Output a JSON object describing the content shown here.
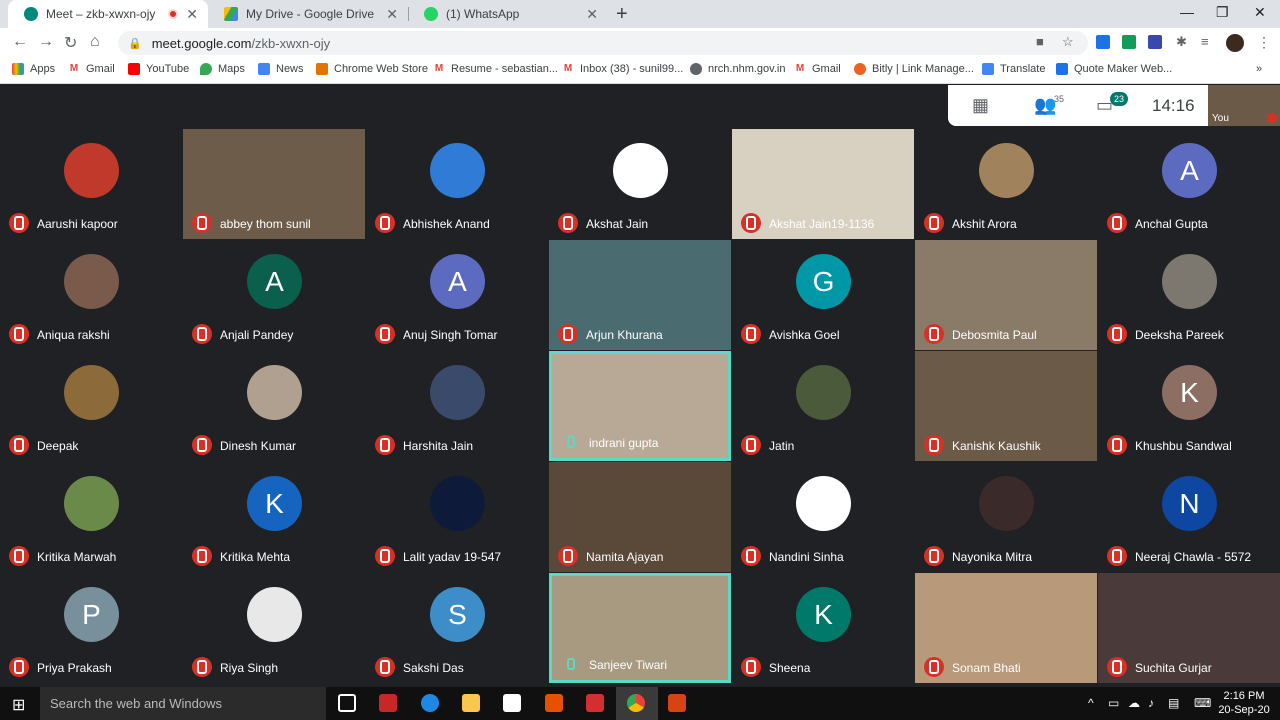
{
  "browser": {
    "tabs": [
      {
        "title": "Meet – zkb-xwxn-ojy",
        "icon": "meet-icon",
        "active": true
      },
      {
        "title": "My Drive - Google Drive",
        "icon": "drive-icon",
        "active": false
      },
      {
        "title": "(1) WhatsApp",
        "icon": "whatsapp-icon",
        "active": false
      }
    ],
    "url_host": "meet.google.com",
    "url_path": "/zkb-xwxn-ojy",
    "bookmarks": [
      "Apps",
      "Gmail",
      "YouTube",
      "Maps",
      "News",
      "Chrome Web Store",
      "Resume - sebastian...",
      "Inbox (38) - sunil99...",
      "nrch.nhm.gov.in",
      "Gmail",
      "Bitly | Link Manage...",
      "Translate",
      "Quote Maker Web..."
    ]
  },
  "meet": {
    "participant_count": "35",
    "chat_count": "23",
    "time": "14:16",
    "self_label": "You",
    "participants": [
      {
        "name": "Aarushi kapoor",
        "kind": "photo",
        "color": "#c0392b"
      },
      {
        "name": "abbey thom sunil",
        "kind": "video",
        "color": "#6e5c4a"
      },
      {
        "name": "Abhishek Anand",
        "kind": "photo",
        "color": "#2f7bd6"
      },
      {
        "name": "Akshat Jain",
        "kind": "photo",
        "color": "#ffffff"
      },
      {
        "name": "Akshat Jain19-1136",
        "kind": "video",
        "color": "#d8d0c0"
      },
      {
        "name": "Akshit Arora",
        "kind": "photo",
        "color": "#a0825c"
      },
      {
        "name": "Anchal Gupta",
        "kind": "letter",
        "letter": "A",
        "color": "#5c6bc0"
      },
      {
        "name": "Aniqua rakshi",
        "kind": "photo",
        "color": "#7a5a4a"
      },
      {
        "name": "Anjali Pandey",
        "kind": "letter",
        "letter": "A",
        "color": "#0b5f4d"
      },
      {
        "name": "Anuj Singh Tomar",
        "kind": "letter",
        "letter": "A",
        "color": "#5c6bc0"
      },
      {
        "name": "Arjun Khurana",
        "kind": "video",
        "color": "#4a6b70"
      },
      {
        "name": "Avishka Goel",
        "kind": "letter",
        "letter": "G",
        "color": "#0097a7"
      },
      {
        "name": "Debosmita Paul",
        "kind": "video",
        "color": "#8a7a68"
      },
      {
        "name": "Deeksha Pareek",
        "kind": "photo",
        "color": "#7c7870"
      },
      {
        "name": "Deepak",
        "kind": "photo",
        "color": "#8c6a3a"
      },
      {
        "name": "Dinesh Kumar",
        "kind": "photo",
        "color": "#b0a090"
      },
      {
        "name": "Harshita Jain",
        "kind": "photo",
        "color": "#3a4a6a"
      },
      {
        "name": "indrani gupta",
        "kind": "video",
        "color": "#b8a896",
        "speaking": true
      },
      {
        "name": "Jatin",
        "kind": "photo",
        "color": "#4a5a3a"
      },
      {
        "name": "Kanishk Kaushik",
        "kind": "video",
        "color": "#6b5a48"
      },
      {
        "name": "Khushbu Sandwal",
        "kind": "letter",
        "letter": "K",
        "color": "#8d6e63"
      },
      {
        "name": "Kritika Marwah",
        "kind": "photo",
        "color": "#6a8a4a"
      },
      {
        "name": "Kritika Mehta",
        "kind": "letter",
        "letter": "K",
        "color": "#1565c0"
      },
      {
        "name": "Lalit yadav 19-547",
        "kind": "photo",
        "color": "#0d1a3a"
      },
      {
        "name": "Namita Ajayan",
        "kind": "video",
        "color": "#5a4838"
      },
      {
        "name": "Nandini Sinha",
        "kind": "photo",
        "color": "#ffffff"
      },
      {
        "name": "Nayonika Mitra",
        "kind": "photo",
        "color": "#3a2a2a"
      },
      {
        "name": "Neeraj Chawla - 5572",
        "kind": "letter",
        "letter": "N",
        "color": "#0d47a1"
      },
      {
        "name": "Priya Prakash",
        "kind": "letter",
        "letter": "P",
        "color": "#78909c"
      },
      {
        "name": "Riya Singh",
        "kind": "photo",
        "color": "#e8e8e8"
      },
      {
        "name": "Sakshi Das",
        "kind": "letter",
        "letter": "S",
        "color": "#3c8dc8"
      },
      {
        "name": "Sanjeev Tiwari",
        "kind": "video",
        "color": "#a89a80",
        "speaking": true
      },
      {
        "name": "Sheena",
        "kind": "letter",
        "letter": "K",
        "color": "#00796b"
      },
      {
        "name": "Sonam Bhati",
        "kind": "video",
        "color": "#b89a7a"
      },
      {
        "name": "Suchita Gurjar",
        "kind": "video",
        "color": "#4a3a3a"
      }
    ]
  },
  "taskbar": {
    "search_placeholder": "Search the web and Windows",
    "time": "2:16 PM",
    "date": "20-Sep-20"
  }
}
